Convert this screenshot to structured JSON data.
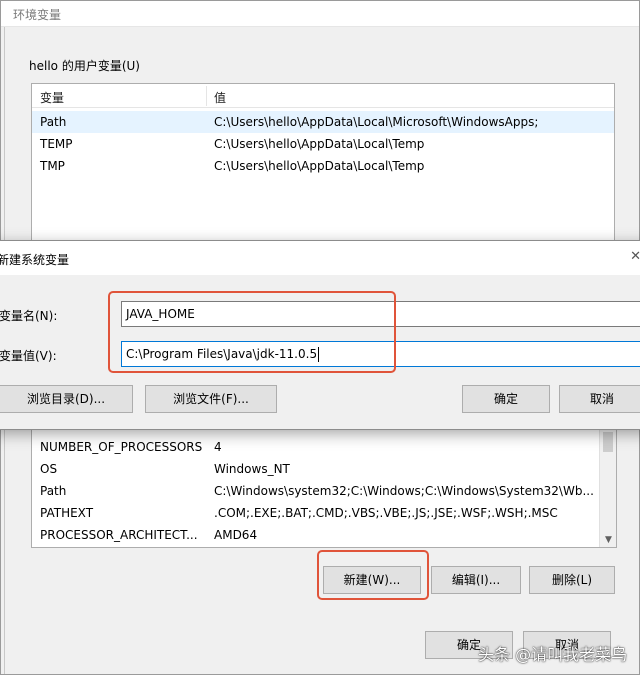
{
  "env_window": {
    "title": "环境变量",
    "user_group_label": "hello 的用户变量(U)",
    "columns": {
      "name": "变量",
      "value": "值"
    },
    "user_vars": [
      {
        "name": "Path",
        "value": "C:\\Users\\hello\\AppData\\Local\\Microsoft\\WindowsApps;"
      },
      {
        "name": "TEMP",
        "value": "C:\\Users\\hello\\AppData\\Local\\Temp"
      },
      {
        "name": "TMP",
        "value": "C:\\Users\\hello\\AppData\\Local\\Temp"
      }
    ],
    "system_vars": [
      {
        "name": "NUMBER_OF_PROCESSORS",
        "value": "4"
      },
      {
        "name": "OS",
        "value": "Windows_NT"
      },
      {
        "name": "Path",
        "value": "C:\\Windows\\system32;C:\\Windows;C:\\Windows\\System32\\Wb..."
      },
      {
        "name": "PATHEXT",
        "value": ".COM;.EXE;.BAT;.CMD;.VBS;.VBE;.JS;.JSE;.WSF;.WSH;.MSC"
      },
      {
        "name": "PROCESSOR_ARCHITECT...",
        "value": "AMD64"
      }
    ],
    "buttons": {
      "new": "新建(W)...",
      "edit": "编辑(I)...",
      "delete": "删除(L)",
      "ok": "确定",
      "cancel": "取消"
    }
  },
  "new_var_dialog": {
    "title": "新建系统变量",
    "name_label": "变量名(N):",
    "value_label": "变量值(V):",
    "name_value": "JAVA_HOME",
    "value_value": "C:\\Program Files\\Java\\jdk-11.0.5",
    "buttons": {
      "browse_dir": "浏览目录(D)...",
      "browse_file": "浏览文件(F)...",
      "ok": "确定",
      "cancel": "取消"
    }
  },
  "watermark": "头条 @请叫我老菜鸟",
  "colors": {
    "highlight": "#e0543a",
    "focus_border": "#0078d7",
    "selection": "#e5f3ff"
  }
}
